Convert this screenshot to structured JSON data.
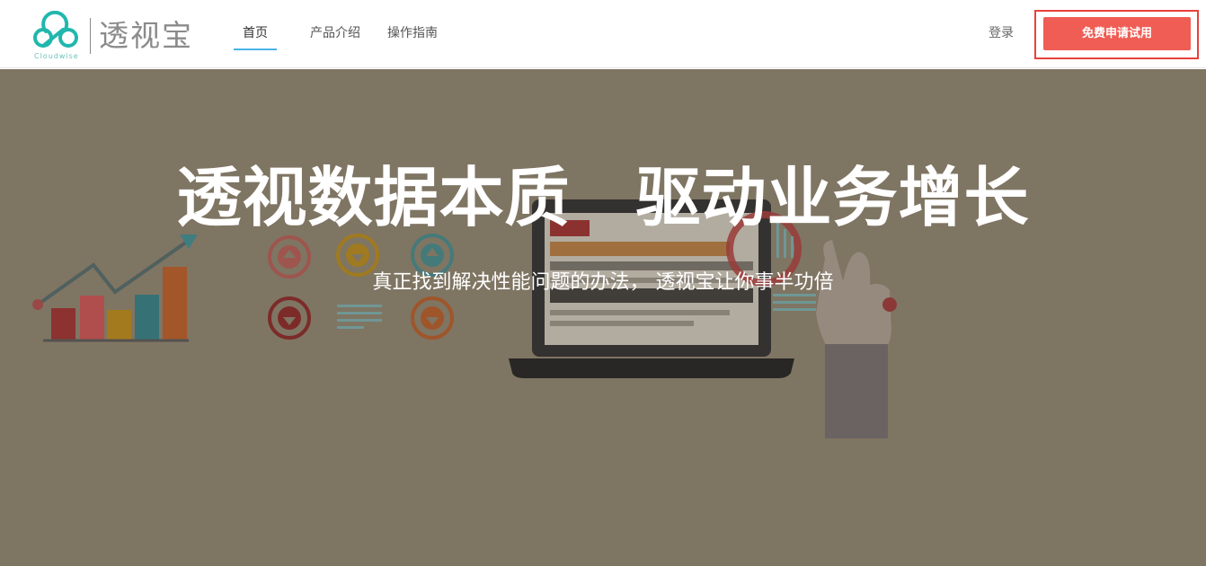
{
  "brand": {
    "name": "透视宝",
    "sub": "Cloudwise",
    "logo_icon": "cloud-logo-icon",
    "accent": "#21b7ad"
  },
  "nav": {
    "items": [
      {
        "label": "首页",
        "active": true
      },
      {
        "label": "产品介绍",
        "active": false
      },
      {
        "label": "操作指南",
        "active": false
      }
    ],
    "active_color": "#4ab3e8"
  },
  "header": {
    "login_label": "登录",
    "cta_label": "免费申请试用",
    "cta_color": "#ef5d54"
  },
  "hero": {
    "title": "透视数据本质　驱动业务增长",
    "subtitle": "真正找到解决性能问题的办法， 透视宝让你事半功倍",
    "background": "#7f7563"
  }
}
